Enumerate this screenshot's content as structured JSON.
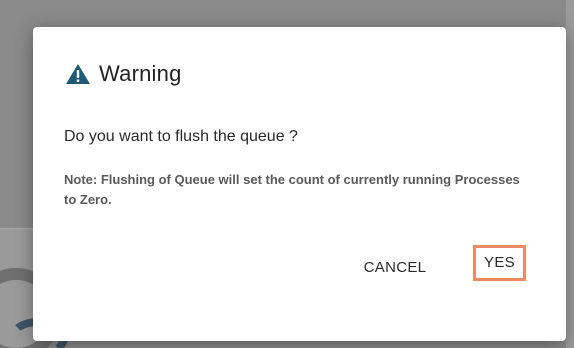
{
  "dialog": {
    "title": "Warning",
    "icon": "warning-icon",
    "question": "Do you want to flush the queue ?",
    "note": "Note: Flushing of Queue will set the count of currently running Processes to Zero.",
    "cancel_label": "CANCEL",
    "yes_label": "YES"
  },
  "colors": {
    "icon": "#1f5a78",
    "highlight": "#ec8a63",
    "overlay": "#8a8a8a"
  }
}
